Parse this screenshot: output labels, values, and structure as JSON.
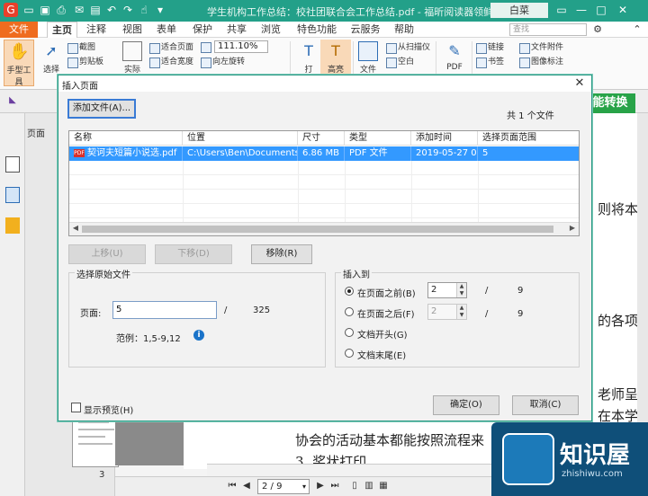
{
  "titlebar": {
    "title": "学生机构工作总结：校社团联合会工作总结.pdf - 福昕阅读器领鲜版",
    "user": "白菜"
  },
  "tabs": {
    "file": "文件",
    "items": [
      "主页",
      "注释",
      "视图",
      "表单",
      "保护",
      "共享",
      "浏览",
      "特色功能",
      "云服务",
      "帮助"
    ],
    "search_placeholder": "查找"
  },
  "ribbon": {
    "hand": "手型工具",
    "select": "选择",
    "screenshot": "截图",
    "clipboard": "剪贴板",
    "actual": "实际",
    "fit_page": "适合页面",
    "fit_width": "适合宽度",
    "zoom": "111.10%",
    "rotate_left": "向左旋转",
    "typewriter": "打",
    "highlight": "高亮",
    "file": "文件",
    "from_scanner": "从扫描仪",
    "blank": "空白",
    "pdf": "PDF",
    "link": "链接",
    "bookmark": "书签",
    "attachment": "文件附件",
    "image_annot": "图像标注"
  },
  "promo": "能转换",
  "thumbnails": {
    "header": "页面",
    "page_num": "3"
  },
  "document": {
    "lines": [
      "则将本学",
      "的各项通",
      "老师呈",
      "在本学",
      "协会的活动基本都能按照流程来",
      "3. 奖状打印"
    ]
  },
  "pagenav": {
    "current": "2 / 9"
  },
  "brand": {
    "name": "知识屋",
    "sub": "zhishiwu.com"
  },
  "dialog": {
    "title": "插入页面",
    "add_file": "添加文件(A)...",
    "file_count": "共 1 个文件",
    "columns": [
      "名称",
      "位置",
      "尺寸",
      "类型",
      "添加时间",
      "选择页面范围"
    ],
    "rows": [
      {
        "name": "契诃夫短篇小说选.pdf",
        "location": "C:\\Users\\Ben\\Documents\\",
        "size": "6.86 MB",
        "type": "PDF 文件",
        "added": "2019-05-27 0...",
        "range": "5"
      }
    ],
    "move_up": "上移(U)",
    "move_down": "下移(D)",
    "remove": "移除(R)",
    "source": {
      "legend": "选择原始文件",
      "pages_label": "页面:",
      "pages_value": "5",
      "slash": "/",
      "total": "325",
      "example": "范例：1,5-9,12"
    },
    "insert_to": {
      "legend": "插入到",
      "before": "在页面之前(B)",
      "after": "在页面之后(F)",
      "start": "文档开头(G)",
      "end": "文档末尾(E)",
      "before_value": "2",
      "after_value": "2",
      "slash": "/",
      "total": "9"
    },
    "preview": "显示预览(H)",
    "ok": "确定(O)",
    "cancel": "取消(C)"
  }
}
